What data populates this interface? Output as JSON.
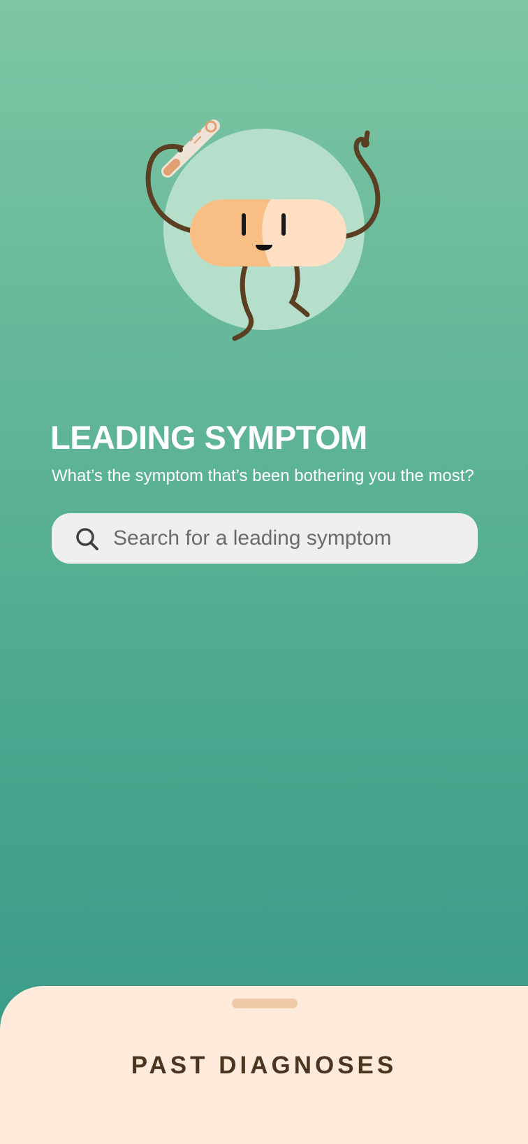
{
  "header": {
    "title": "LEADING SYMPTOM",
    "subtitle": "What’s the symptom that’s been bothering you the most?"
  },
  "illustration": {
    "name": "pill-mascot-with-thermometer",
    "icons": [
      "pill-mascot-icon",
      "thermometer-icon"
    ]
  },
  "search": {
    "placeholder": "Search for a leading symptom",
    "value": "",
    "icon": "search-icon"
  },
  "bottom_sheet": {
    "title": "PAST DIAGNOSES"
  },
  "colors": {
    "gradient_top": "#7dc6a4",
    "gradient_bottom": "#36998a",
    "search_bg": "#efefef",
    "sheet_bg": "#ffebdc",
    "sheet_handle": "#f0c9a9",
    "sheet_title": "#4b351f",
    "pill_left": "#f8be84",
    "pill_right": "#ffe0c4",
    "limb": "#5b3f22"
  }
}
